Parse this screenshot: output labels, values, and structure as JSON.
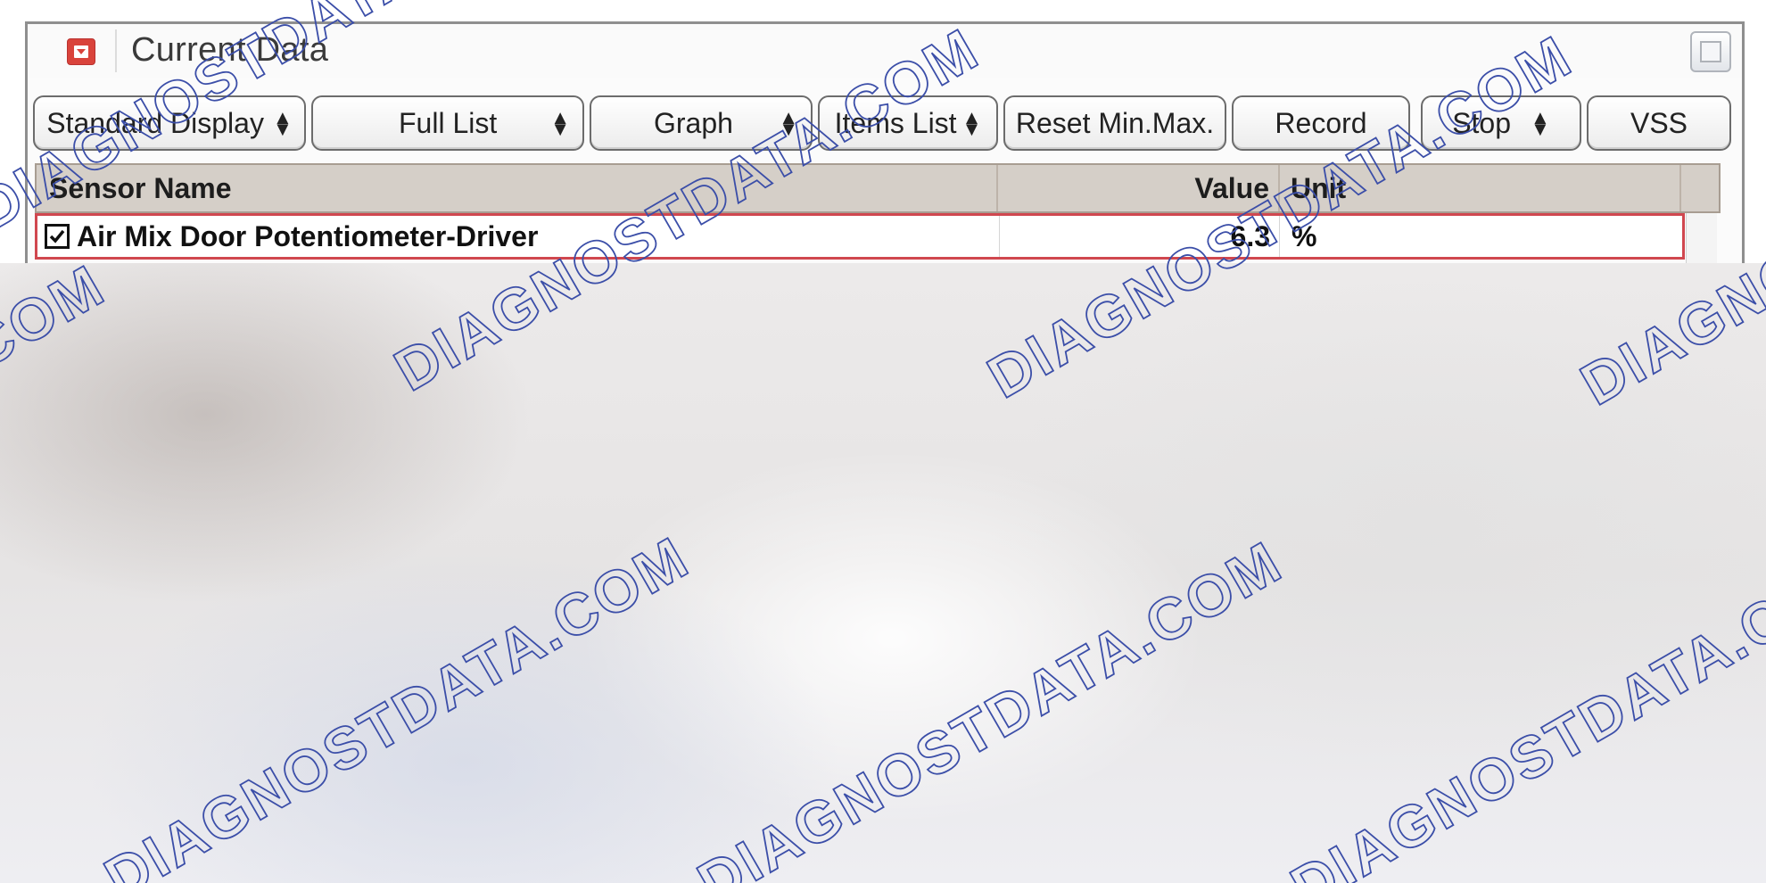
{
  "panel": {
    "title": "Current Data"
  },
  "toolbar": {
    "buttons": [
      {
        "label": "Standard Display",
        "has_arrows": true
      },
      {
        "label": "Full List",
        "has_arrows": true
      },
      {
        "label": "Graph",
        "has_arrows": true
      },
      {
        "label": "Items List",
        "has_arrows": true
      },
      {
        "label": "Reset Min.Max.",
        "has_arrows": false
      },
      {
        "label": "Record",
        "has_arrows": false
      },
      {
        "label": "Stop",
        "has_arrows": true
      },
      {
        "label": "VSS",
        "has_arrows": false
      }
    ]
  },
  "table": {
    "columns": {
      "sensor_name": "Sensor Name",
      "value": "Value",
      "unit": "Unit"
    },
    "rows": [
      {
        "checked": true,
        "sensor_name": "Air Mix Door Potentiometer-Driver",
        "value": "6.3",
        "unit": "%"
      }
    ]
  },
  "watermark": {
    "text": "DIAGNOSTDATA.COM",
    "color": "#3b4ea8"
  },
  "colors": {
    "row_highlight": "#d0474f",
    "collapse_button": "#d9433b",
    "header_bg": "#d5cfc8"
  }
}
